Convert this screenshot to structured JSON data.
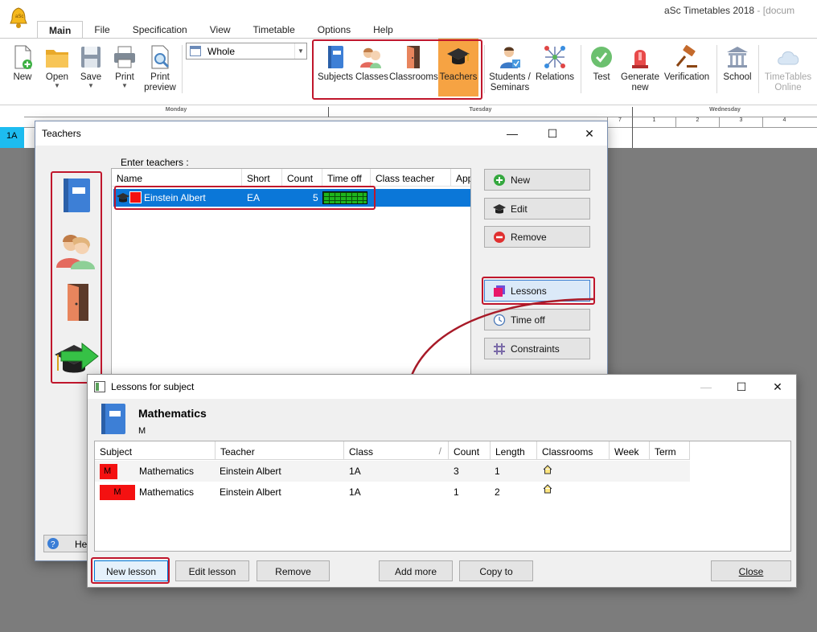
{
  "app": {
    "title": "aSc Timetables 2018",
    "title_suffix": "- [docum",
    "menu_tabs": [
      "Main",
      "File",
      "Specification",
      "View",
      "Timetable",
      "Options",
      "Help"
    ]
  },
  "ribbon": {
    "new": "New",
    "open": "Open",
    "save": "Save",
    "print": "Print",
    "print_preview_1": "Print",
    "print_preview_2": "preview",
    "view_select": "Whole",
    "subjects": "Subjects",
    "classes": "Classes",
    "classrooms": "Classrooms",
    "teachers": "Teachers",
    "students_1": "Students /",
    "students_2": "Seminars",
    "relations": "Relations",
    "test": "Test",
    "generate_1": "Generate",
    "generate_2": "new",
    "verification": "Verification",
    "school": "School",
    "online_1": "TimeTables",
    "online_2": "Online"
  },
  "timetable": {
    "class_label": "1A",
    "days": [
      "Monday",
      "Tuesday",
      "Wednesday"
    ],
    "periods": [
      "1",
      "2",
      "3",
      "4"
    ],
    "last_period": "7"
  },
  "teachers_dialog": {
    "title": "Teachers",
    "enter_label": "Enter teachers :",
    "columns": [
      "Name",
      "Short",
      "Count",
      "Time off",
      "Class teacher",
      "App"
    ],
    "row": {
      "name": "Einstein Albert",
      "short": "EA",
      "count": "5"
    },
    "buttons": {
      "new": "New",
      "edit": "Edit",
      "remove": "Remove",
      "lessons": "Lessons",
      "time_off": "Time off",
      "constraints": "Constraints"
    },
    "help": "Hel"
  },
  "lessons_dialog": {
    "title": "Lessons for subject",
    "subject_name": "Mathematics",
    "subject_short": "M",
    "columns": [
      "Subject",
      "Teacher",
      "Class",
      "Count",
      "Length",
      "Classrooms",
      "Week",
      "Term"
    ],
    "rows": [
      {
        "badge": "M",
        "subject": "Mathematics",
        "teacher": "Einstein Albert",
        "class": "1A",
        "count": "3",
        "length": "1"
      },
      {
        "badge": "M",
        "subject": "Mathematics",
        "teacher": "Einstein Albert",
        "class": "1A",
        "count": "1",
        "length": "2"
      }
    ],
    "buttons": {
      "new_lesson": "New lesson",
      "edit_lesson": "Edit lesson",
      "remove": "Remove",
      "add_more": "Add more",
      "copy_to": "Copy to",
      "close": "Close"
    }
  },
  "colors": {
    "highlight": "#c0162c",
    "selection": "#0b77d8",
    "teacher_color": "#f41111",
    "active_ribbon": "#f6a343"
  }
}
